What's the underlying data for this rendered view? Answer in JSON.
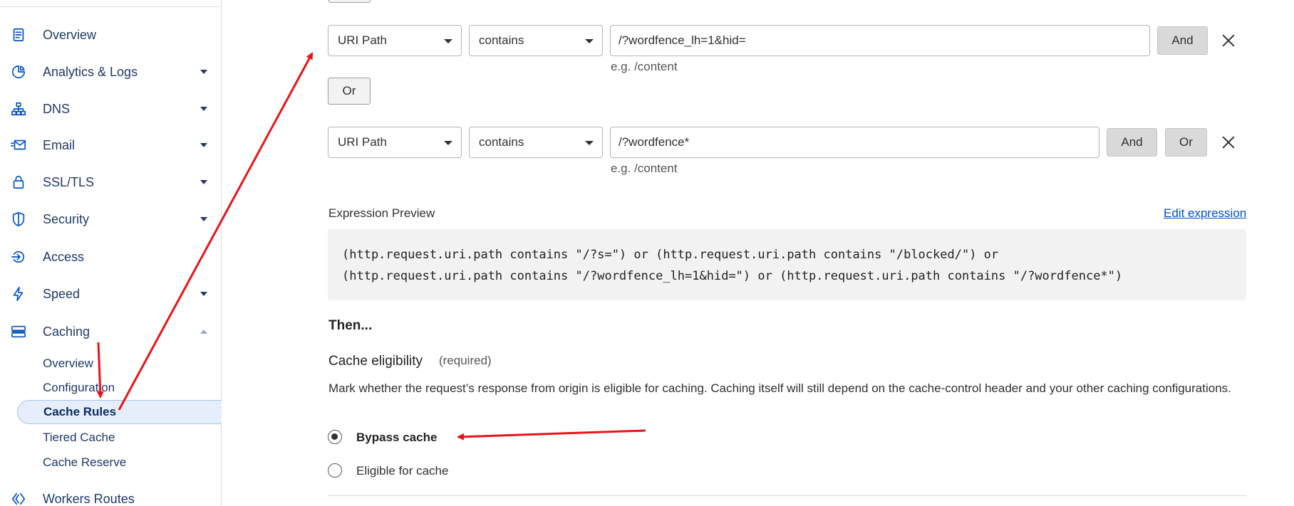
{
  "sidebar": {
    "items": [
      {
        "label": "Overview",
        "icon": "document-icon",
        "has_caret": false
      },
      {
        "label": "Analytics & Logs",
        "icon": "pie-chart-icon",
        "has_caret": true
      },
      {
        "label": "DNS",
        "icon": "network-icon",
        "has_caret": true
      },
      {
        "label": "Email",
        "icon": "envelope-icon",
        "has_caret": true
      },
      {
        "label": "SSL/TLS",
        "icon": "lock-icon",
        "has_caret": true
      },
      {
        "label": "Security",
        "icon": "shield-icon",
        "has_caret": true
      },
      {
        "label": "Access",
        "icon": "access-icon",
        "has_caret": false
      },
      {
        "label": "Speed",
        "icon": "lightning-icon",
        "has_caret": true
      },
      {
        "label": "Caching",
        "icon": "server-icon",
        "has_caret": true,
        "expanded": true
      },
      {
        "label": "Workers Routes",
        "icon": "workers-icon",
        "has_caret": false
      }
    ],
    "caching_subitems": [
      {
        "label": "Overview"
      },
      {
        "label": "Configuration"
      },
      {
        "label": "Cache Rules",
        "active": true
      },
      {
        "label": "Tiered Cache"
      },
      {
        "label": "Cache Reserve"
      }
    ]
  },
  "rules": [
    {
      "field": "URI Path",
      "operator": "contains",
      "value": "/?wordfence_lh=1&hid=",
      "hint": "e.g. /content",
      "buttons": [
        "And"
      ]
    },
    {
      "field": "URI Path",
      "operator": "contains",
      "value": "/?wordfence*",
      "hint": "e.g. /content",
      "buttons": [
        "And",
        "Or"
      ]
    }
  ],
  "or_button_label": "Or",
  "expression_preview": {
    "label": "Expression Preview",
    "edit_link": "Edit expression",
    "line1": "(http.request.uri.path contains \"/?s=\") or (http.request.uri.path contains \"/blocked/\") or",
    "line2": "(http.request.uri.path contains \"/?wordfence_lh=1&hid=\") or (http.request.uri.path contains \"/?wordfence*\")"
  },
  "then": {
    "heading": "Then...",
    "field_title": "Cache eligibility",
    "required": "(required)",
    "description": "Mark whether the request’s response from origin is eligible for caching. Caching itself will still depend on the cache-control header and your other caching configurations.",
    "options": [
      {
        "label": "Bypass cache",
        "selected": true
      },
      {
        "label": "Eligible for cache",
        "selected": false
      }
    ]
  },
  "colors": {
    "accent": "#0051c3",
    "annotation_arrow": "#e8141a"
  }
}
